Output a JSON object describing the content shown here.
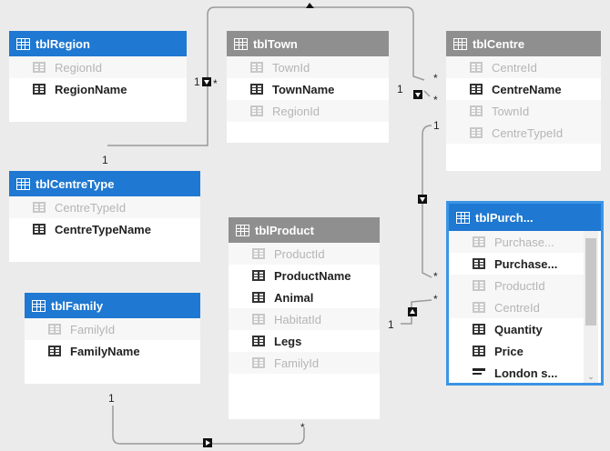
{
  "tables": {
    "region": {
      "name": "tblRegion",
      "fields": [
        {
          "label": "RegionId",
          "hidden": true
        },
        {
          "label": "RegionName",
          "hidden": false
        }
      ]
    },
    "town": {
      "name": "tblTown",
      "fields": [
        {
          "label": "TownId",
          "hidden": true
        },
        {
          "label": "TownName",
          "hidden": false
        },
        {
          "label": "RegionId",
          "hidden": true
        }
      ]
    },
    "centre": {
      "name": "tblCentre",
      "fields": [
        {
          "label": "CentreId",
          "hidden": true
        },
        {
          "label": "CentreName",
          "hidden": false
        },
        {
          "label": "TownId",
          "hidden": true
        },
        {
          "label": "CentreTypeId",
          "hidden": true
        }
      ]
    },
    "centreType": {
      "name": "tblCentreType",
      "fields": [
        {
          "label": "CentreTypeId",
          "hidden": true
        },
        {
          "label": "CentreTypeName",
          "hidden": false
        }
      ]
    },
    "product": {
      "name": "tblProduct",
      "fields": [
        {
          "label": "ProductId",
          "hidden": true
        },
        {
          "label": "ProductName",
          "hidden": false
        },
        {
          "label": "Animal",
          "hidden": false
        },
        {
          "label": "HabitatId",
          "hidden": true
        },
        {
          "label": "Legs",
          "hidden": false
        },
        {
          "label": "FamilyId",
          "hidden": true
        }
      ]
    },
    "family": {
      "name": "tblFamily",
      "fields": [
        {
          "label": "FamilyId",
          "hidden": true
        },
        {
          "label": "FamilyName",
          "hidden": false
        }
      ]
    },
    "purchase": {
      "name": "tblPurch...",
      "fields": [
        {
          "label": "Purchase...",
          "hidden": true
        },
        {
          "label": "Purchase...",
          "hidden": false
        },
        {
          "label": "ProductId",
          "hidden": true
        },
        {
          "label": "CentreId",
          "hidden": true
        },
        {
          "label": "Quantity",
          "hidden": false
        },
        {
          "label": "Price",
          "hidden": false
        },
        {
          "label": "London s...",
          "hidden": false,
          "measure": true
        }
      ]
    }
  },
  "cardinality": {
    "one": "1",
    "many": "*"
  },
  "colors": {
    "selected_header": "#1f78d1",
    "unselected_header": "#8f8f8f",
    "selection_outline": "#3a94e6"
  },
  "icons": {
    "table": "table-icon",
    "field": "field-icon",
    "measure": "measure-icon",
    "filter_direction": "triangle-arrow-icon"
  }
}
